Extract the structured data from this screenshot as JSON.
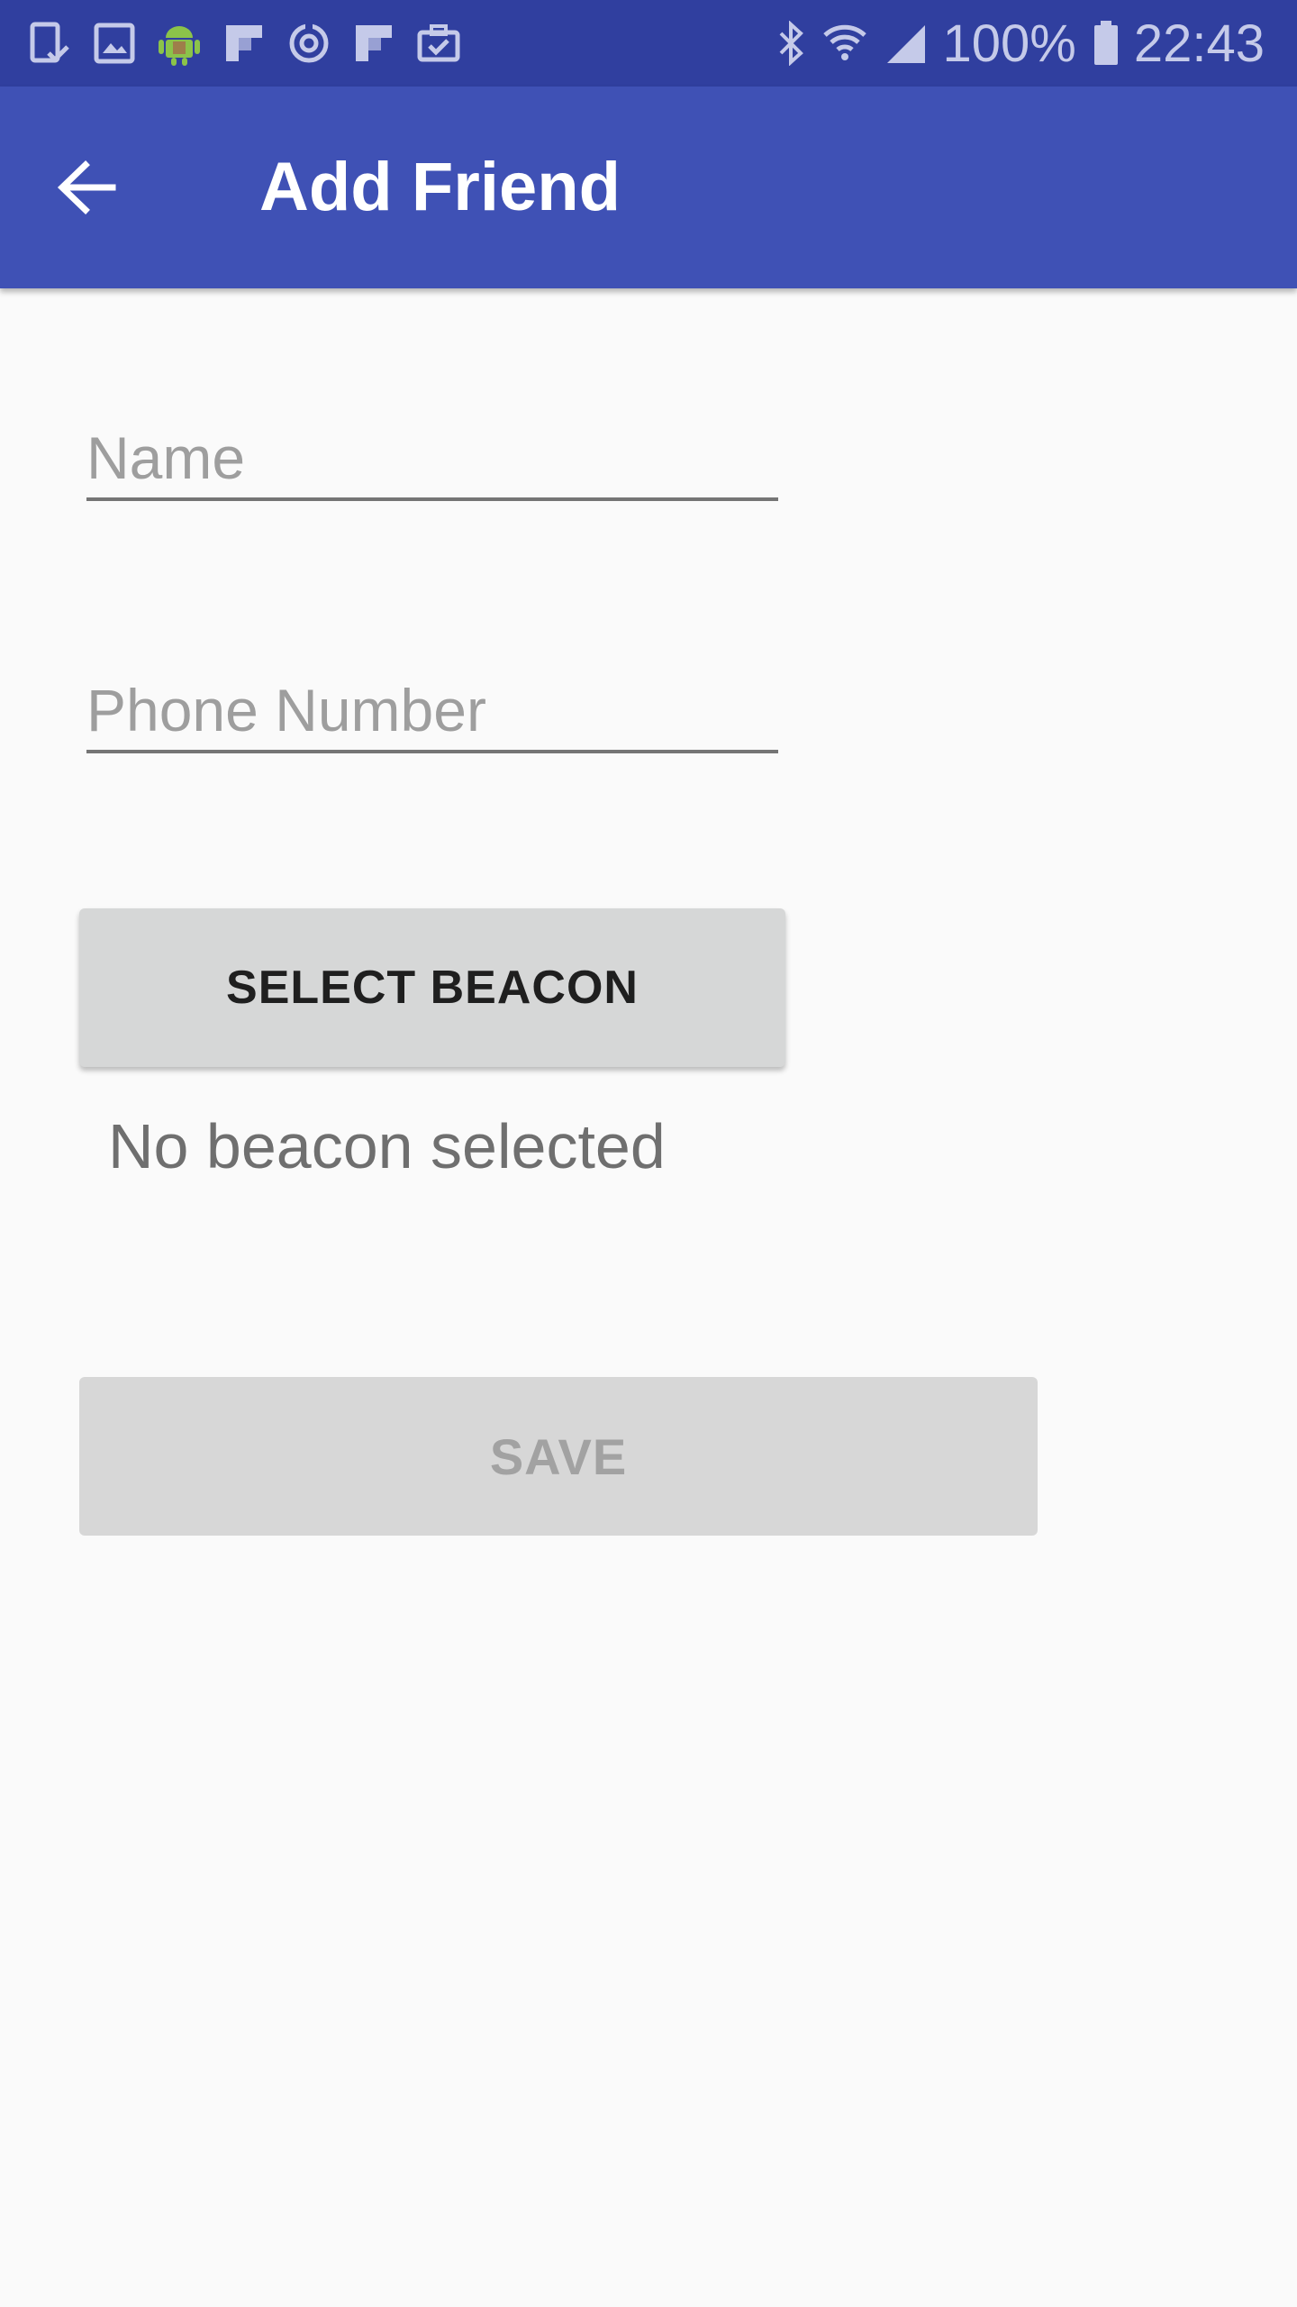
{
  "status_bar": {
    "battery": "100%",
    "time": "22:43",
    "left_icons": [
      "device-check-icon",
      "image-icon",
      "android-icon",
      "flipboard-icon",
      "sync-icon",
      "flipboard-icon",
      "briefcase-check-icon"
    ],
    "right_icons": [
      "bluetooth-icon",
      "wifi-icon",
      "signal-icon",
      "battery-icon"
    ]
  },
  "app_bar": {
    "title": "Add Friend",
    "back_icon": "arrow-back-icon",
    "color": "#3f51b5"
  },
  "form": {
    "name_placeholder": "Name",
    "name_value": "",
    "phone_placeholder": "Phone Number",
    "phone_value": ""
  },
  "beacon": {
    "button_label": "SELECT BEACON",
    "status_text": "No beacon selected"
  },
  "save": {
    "label": "SAVE"
  },
  "colors": {
    "status_bar": "#303f9f",
    "app_bar": "#3f51b5",
    "background": "#fafafa"
  }
}
